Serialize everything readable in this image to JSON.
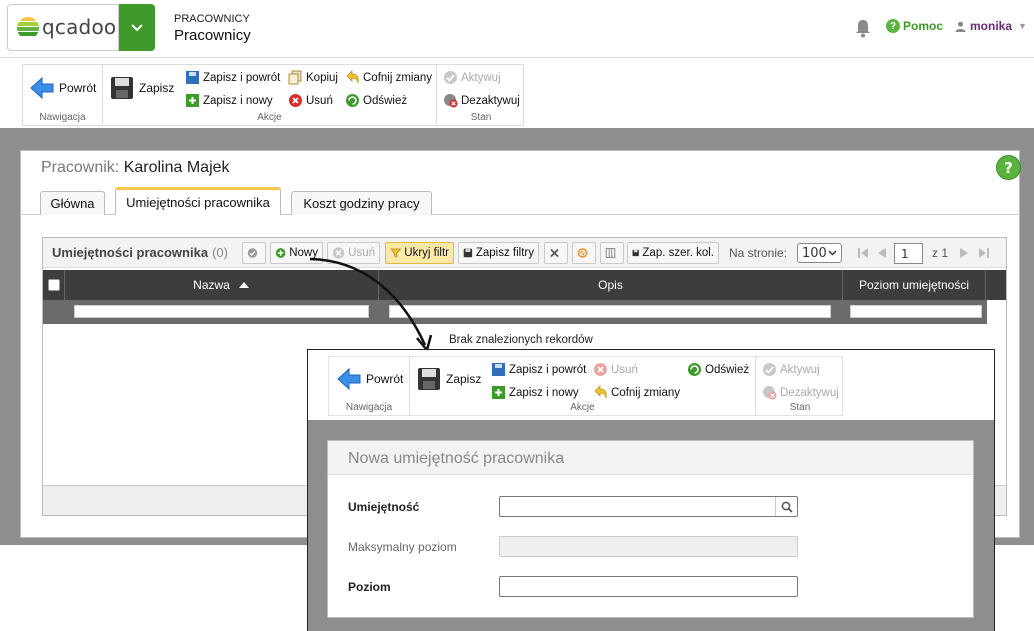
{
  "header": {
    "logo_text": "qcadoo",
    "category": "PRACOWNICY",
    "title": "Pracownicy",
    "help_label": "Pomoc",
    "user_name": "monika"
  },
  "main_ribbon": {
    "groups": {
      "navigation": "Nawigacja",
      "actions": "Akcje",
      "state": "Stan"
    },
    "back": "Powrót",
    "save": "Zapisz",
    "save_back": "Zapisz i powrót",
    "save_new": "Zapisz i nowy",
    "copy": "Kopiuj",
    "delete": "Usuń",
    "undo": "Cofnij zmiany",
    "refresh": "Odśwież",
    "activate": "Aktywuj",
    "deactivate": "Dezaktywuj"
  },
  "panel": {
    "title_label": "Pracownik:",
    "title_value": "Karolina Majek",
    "tabs": [
      "Główna",
      "Umiejętności pracownika",
      "Koszt godziny pracy"
    ]
  },
  "grid": {
    "title": "Umiejętności pracownika",
    "count": "(0)",
    "buttons": {
      "new": "Nowy",
      "delete": "Usuń",
      "hide_filter": "Ukryj filtr",
      "save_filters": "Zapisz filtry",
      "save_columns": "Zap. szer. kol."
    },
    "per_page_label": "Na stronie:",
    "per_page_value": "100",
    "page_value": "1",
    "page_of": "z 1",
    "columns": [
      "Nazwa",
      "Opis",
      "Poziom umiejętności"
    ],
    "empty_text": "Brak znalezionych rekordów"
  },
  "popup_ribbon": {
    "groups": {
      "navigation": "Nawigacja",
      "actions": "Akcje",
      "state": "Stan"
    },
    "back": "Powrót",
    "save": "Zapisz",
    "save_back": "Zapisz i powrót",
    "save_new": "Zapisz i nowy",
    "delete": "Usuń",
    "undo": "Cofnij zmiany",
    "refresh": "Odśwież",
    "activate": "Aktywuj",
    "deactivate": "Dezaktywuj"
  },
  "form": {
    "title": "Nowa umiejętność pracownika",
    "skill_label": "Umiejętność",
    "skill_value": "",
    "max_level_label": "Maksymalny poziom",
    "max_level_value": "",
    "level_label": "Poziom",
    "level_value": ""
  },
  "colors": {
    "brand_green": "#3d9a2b",
    "tab_accent": "#f2c94c",
    "user_purple": "#6a2c7a",
    "grid_header": "#3d3d3d"
  }
}
